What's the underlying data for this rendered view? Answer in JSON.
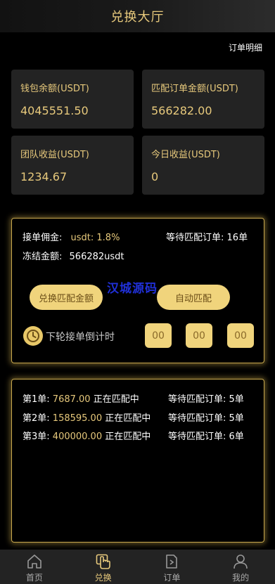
{
  "header": {
    "title": "兑换大厅"
  },
  "order_link": "订单明细",
  "stats": [
    {
      "label": "钱包余额(USDT)",
      "value": "4045551.50"
    },
    {
      "label": "匹配订单金额(USDT)",
      "value": "566282.00"
    },
    {
      "label": "团队收益(USDT)",
      "value": "1234.67"
    },
    {
      "label": "今日收益(USDT)",
      "value": "0"
    }
  ],
  "info": {
    "commission_label": "接单佣金:",
    "commission_value": "usdt: 1.8%",
    "waiting_label": "等待匹配订单:",
    "waiting_value": "16单",
    "frozen_label": "冻结金额:",
    "frozen_value": "566282usdt"
  },
  "watermark": "汉城源码",
  "buttons": {
    "exchange_match": "兑换匹配金额",
    "auto_match": "自动匹配"
  },
  "countdown": {
    "label": "下轮接单倒计时",
    "h": "00",
    "m": "00",
    "s": "00"
  },
  "queue": [
    {
      "name": "第1单:",
      "amount": "7687.00",
      "status": "正在匹配中",
      "waiting_label": "等待匹配订单:",
      "waiting_count": "5单"
    },
    {
      "name": "第2单:",
      "amount": "158595.00",
      "status": "正在匹配中",
      "waiting_label": "等待匹配订单:",
      "waiting_count": "5单"
    },
    {
      "name": "第3单:",
      "amount": "400000.00",
      "status": "正在匹配中",
      "waiting_label": "等待匹配订单:",
      "waiting_count": "6单"
    }
  ],
  "tabbar": [
    {
      "label": "首页",
      "icon": "home-icon",
      "active": false
    },
    {
      "label": "兑换",
      "icon": "exchange-hand-icon",
      "active": true
    },
    {
      "label": "订单",
      "icon": "order-icon",
      "active": false
    },
    {
      "label": "我的",
      "icon": "user-icon",
      "active": false
    }
  ],
  "colors": {
    "accent": "#e7c97c",
    "button": "#f0d47c",
    "card": "#232323",
    "background": "#000000"
  }
}
